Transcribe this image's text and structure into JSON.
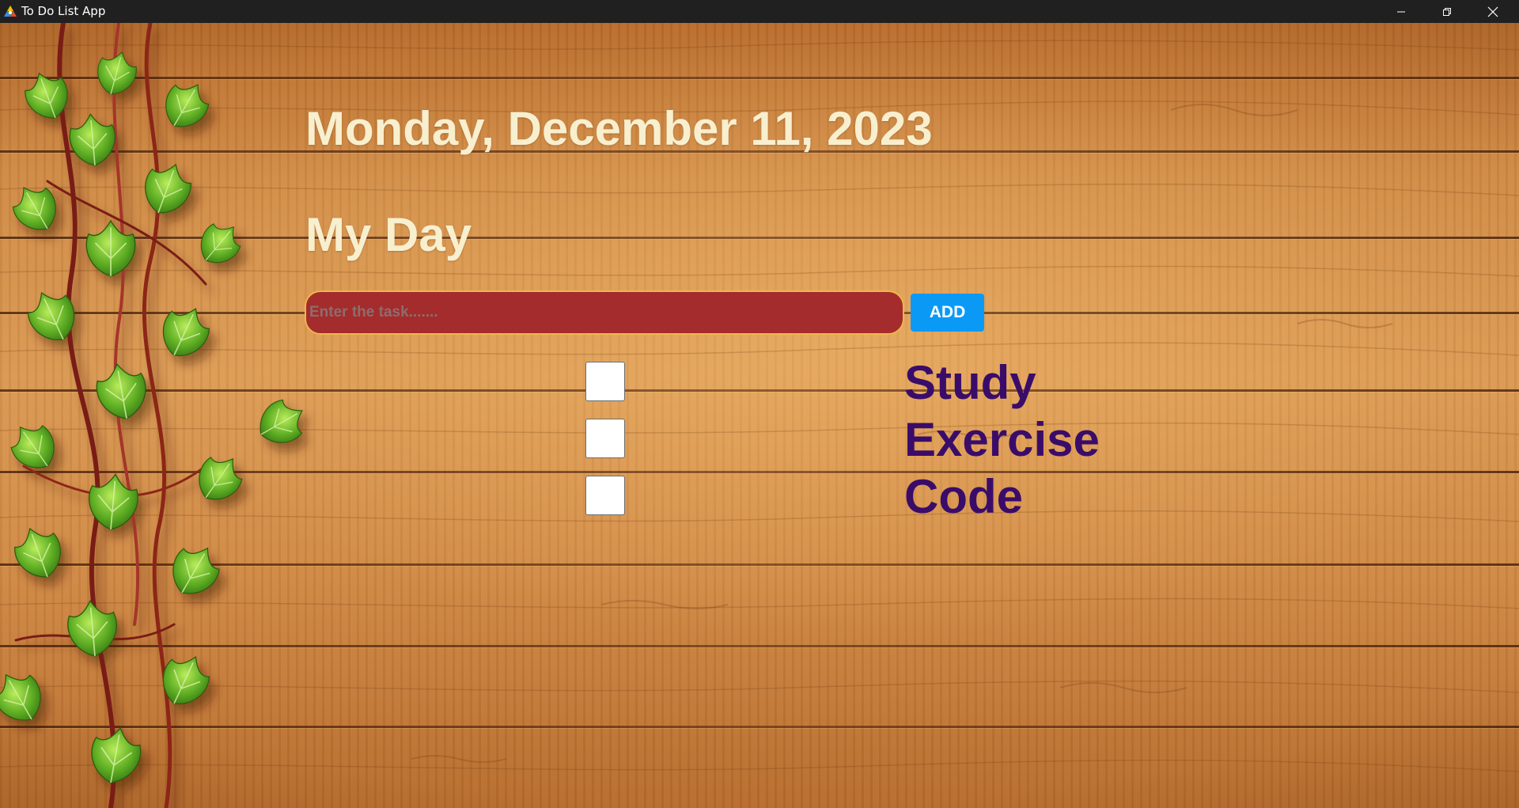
{
  "window": {
    "title": "To Do List App",
    "icon": "triangle-app-icon",
    "controls": [
      "minimize-icon",
      "maximize-icon",
      "close-icon"
    ]
  },
  "header": {
    "date": "Monday, December 11, 2023",
    "list_title": "My Day"
  },
  "task_input": {
    "placeholder": "Enter the task.......",
    "value": ""
  },
  "add_button": {
    "label": "ADD"
  },
  "tasks": [
    {
      "label": "Study",
      "checked": false
    },
    {
      "label": "Exercise",
      "checked": false
    },
    {
      "label": "Code",
      "checked": false
    }
  ],
  "colors": {
    "heading_text": "#f8efcf",
    "input_background": "#a42c2c",
    "input_border": "#f0b64a",
    "add_button": "#0a9af6",
    "task_text": "#3a0c6a",
    "titlebar": "#202020"
  }
}
